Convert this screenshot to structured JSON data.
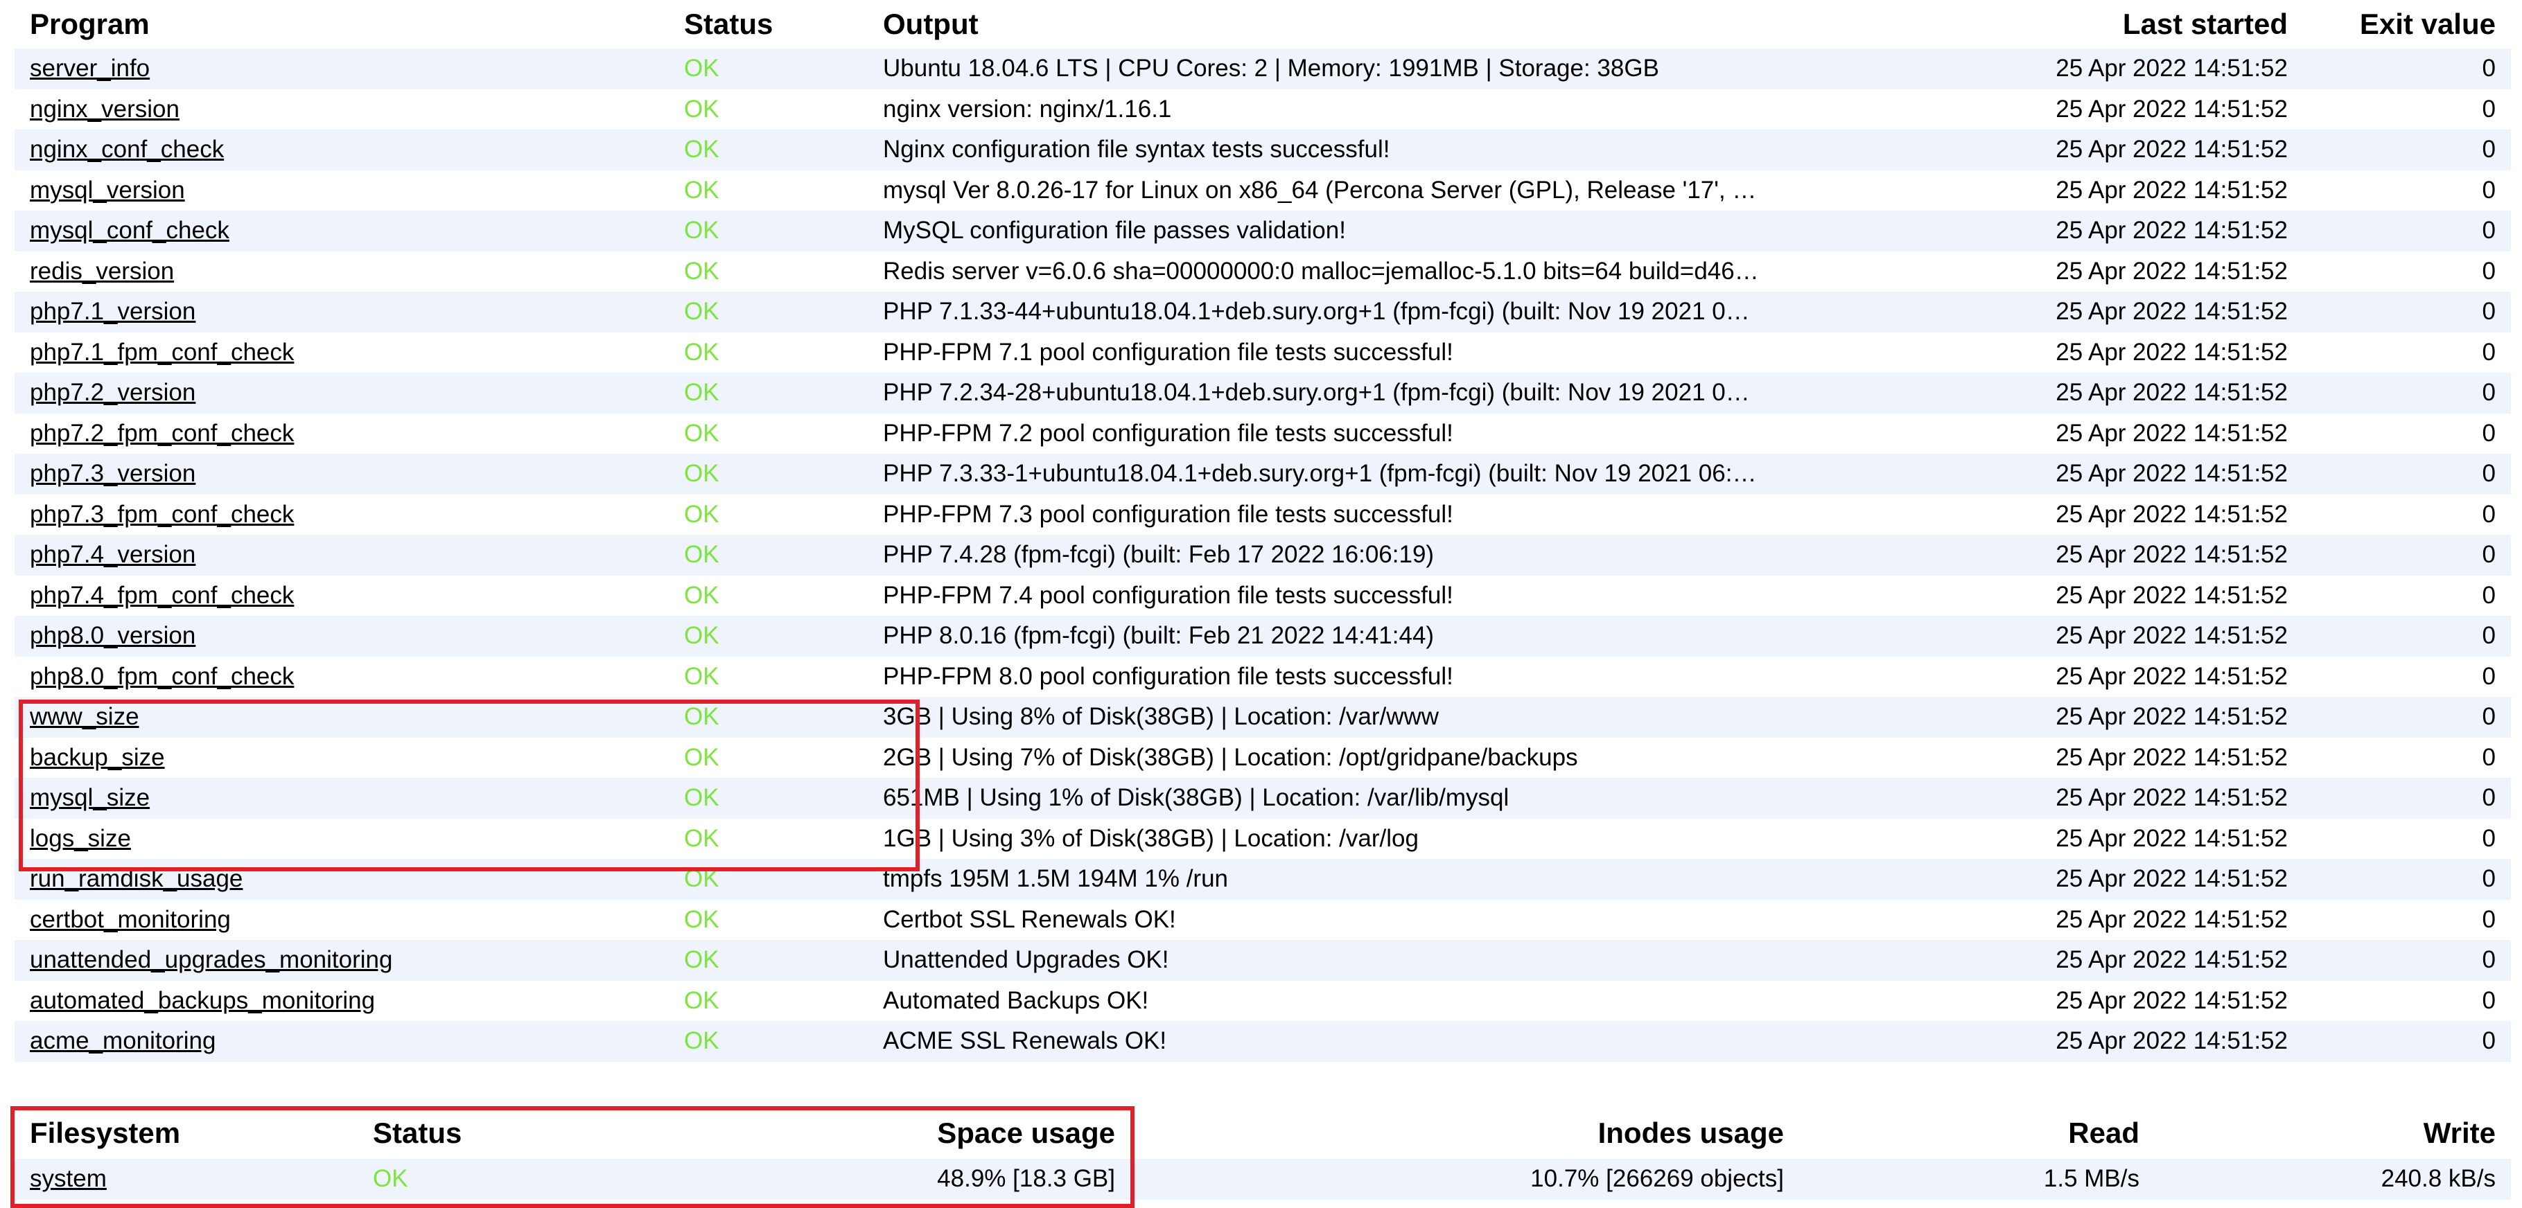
{
  "programs": {
    "headers": {
      "program": "Program",
      "status": "Status",
      "output": "Output",
      "last_started": "Last started",
      "exit_value": "Exit value"
    },
    "rows": [
      {
        "program": "server_info",
        "status": "OK",
        "output": "Ubuntu 18.04.6 LTS | CPU Cores: 2 | Memory: 1991MB | Storage: 38GB",
        "last_started": "25 Apr 2022 14:51:52",
        "exit_value": "0"
      },
      {
        "program": "nginx_version",
        "status": "OK",
        "output": "nginx version: nginx/1.16.1",
        "last_started": "25 Apr 2022 14:51:52",
        "exit_value": "0"
      },
      {
        "program": "nginx_conf_check",
        "status": "OK",
        "output": "Nginx configuration file syntax tests successful!",
        "last_started": "25 Apr 2022 14:51:52",
        "exit_value": "0"
      },
      {
        "program": "mysql_version",
        "status": "OK",
        "output": "mysql Ver 8.0.26-17 for Linux on x86_64 (Percona Server (GPL), Release '17', …",
        "last_started": "25 Apr 2022 14:51:52",
        "exit_value": "0"
      },
      {
        "program": "mysql_conf_check",
        "status": "OK",
        "output": "MySQL configuration file passes validation!",
        "last_started": "25 Apr 2022 14:51:52",
        "exit_value": "0"
      },
      {
        "program": "redis_version",
        "status": "OK",
        "output": "Redis server v=6.0.6 sha=00000000:0 malloc=jemalloc-5.1.0 bits=64 build=d46…",
        "last_started": "25 Apr 2022 14:51:52",
        "exit_value": "0"
      },
      {
        "program": "php7.1_version",
        "status": "OK",
        "output": "PHP 7.1.33-44+ubuntu18.04.1+deb.sury.org+1 (fpm-fcgi) (built: Nov 19 2021 0…",
        "last_started": "25 Apr 2022 14:51:52",
        "exit_value": "0"
      },
      {
        "program": "php7.1_fpm_conf_check",
        "status": "OK",
        "output": "PHP-FPM 7.1 pool configuration file tests successful!",
        "last_started": "25 Apr 2022 14:51:52",
        "exit_value": "0"
      },
      {
        "program": "php7.2_version",
        "status": "OK",
        "output": "PHP 7.2.34-28+ubuntu18.04.1+deb.sury.org+1 (fpm-fcgi) (built: Nov 19 2021 0…",
        "last_started": "25 Apr 2022 14:51:52",
        "exit_value": "0"
      },
      {
        "program": "php7.2_fpm_conf_check",
        "status": "OK",
        "output": "PHP-FPM 7.2 pool configuration file tests successful!",
        "last_started": "25 Apr 2022 14:51:52",
        "exit_value": "0"
      },
      {
        "program": "php7.3_version",
        "status": "OK",
        "output": "PHP 7.3.33-1+ubuntu18.04.1+deb.sury.org+1 (fpm-fcgi) (built: Nov 19 2021 06:…",
        "last_started": "25 Apr 2022 14:51:52",
        "exit_value": "0"
      },
      {
        "program": "php7.3_fpm_conf_check",
        "status": "OK",
        "output": "PHP-FPM 7.3 pool configuration file tests successful!",
        "last_started": "25 Apr 2022 14:51:52",
        "exit_value": "0"
      },
      {
        "program": "php7.4_version",
        "status": "OK",
        "output": "PHP 7.4.28 (fpm-fcgi) (built: Feb 17 2022 16:06:19)",
        "last_started": "25 Apr 2022 14:51:52",
        "exit_value": "0"
      },
      {
        "program": "php7.4_fpm_conf_check",
        "status": "OK",
        "output": "PHP-FPM 7.4 pool configuration file tests successful!",
        "last_started": "25 Apr 2022 14:51:52",
        "exit_value": "0"
      },
      {
        "program": "php8.0_version",
        "status": "OK",
        "output": "PHP 8.0.16 (fpm-fcgi) (built: Feb 21 2022 14:41:44)",
        "last_started": "25 Apr 2022 14:51:52",
        "exit_value": "0"
      },
      {
        "program": "php8.0_fpm_conf_check",
        "status": "OK",
        "output": "PHP-FPM 8.0 pool configuration file tests successful!",
        "last_started": "25 Apr 2022 14:51:52",
        "exit_value": "0"
      },
      {
        "program": "www_size",
        "status": "OK",
        "output": "3GB | Using 8% of Disk(38GB) | Location: /var/www",
        "last_started": "25 Apr 2022 14:51:52",
        "exit_value": "0"
      },
      {
        "program": "backup_size",
        "status": "OK",
        "output": "2GB | Using 7% of Disk(38GB) | Location: /opt/gridpane/backups",
        "last_started": "25 Apr 2022 14:51:52",
        "exit_value": "0"
      },
      {
        "program": "mysql_size",
        "status": "OK",
        "output": "651MB | Using 1% of Disk(38GB) | Location: /var/lib/mysql",
        "last_started": "25 Apr 2022 14:51:52",
        "exit_value": "0"
      },
      {
        "program": "logs_size",
        "status": "OK",
        "output": "1GB | Using 3% of Disk(38GB) | Location: /var/log",
        "last_started": "25 Apr 2022 14:51:52",
        "exit_value": "0"
      },
      {
        "program": "run_ramdisk_usage",
        "status": "OK",
        "output": "tmpfs 195M 1.5M 194M 1% /run",
        "last_started": "25 Apr 2022 14:51:52",
        "exit_value": "0"
      },
      {
        "program": "certbot_monitoring",
        "status": "OK",
        "output": "Certbot SSL Renewals OK!",
        "last_started": "25 Apr 2022 14:51:52",
        "exit_value": "0"
      },
      {
        "program": "unattended_upgrades_monitoring",
        "status": "OK",
        "output": "Unattended Upgrades OK!",
        "last_started": "25 Apr 2022 14:51:52",
        "exit_value": "0"
      },
      {
        "program": "automated_backups_monitoring",
        "status": "OK",
        "output": "Automated Backups OK!",
        "last_started": "25 Apr 2022 14:51:52",
        "exit_value": "0"
      },
      {
        "program": "acme_monitoring",
        "status": "OK",
        "output": "ACME SSL Renewals OK!",
        "last_started": "25 Apr 2022 14:51:52",
        "exit_value": "0"
      }
    ]
  },
  "filesystems": {
    "headers": {
      "filesystem": "Filesystem",
      "status": "Status",
      "space_usage": "Space usage",
      "inodes_usage": "Inodes usage",
      "read": "Read",
      "write": "Write"
    },
    "rows": [
      {
        "filesystem": "system",
        "status": "OK",
        "space_usage": "48.9% [18.3 GB]",
        "inodes_usage": "10.7% [266269 objects]",
        "read": "1.5 MB/s",
        "write": "240.8 kB/s"
      }
    ]
  },
  "colors": {
    "status_ok": "#7ee43f",
    "row_stripe": "#eef3fc",
    "highlight_border": "#e3202a"
  }
}
